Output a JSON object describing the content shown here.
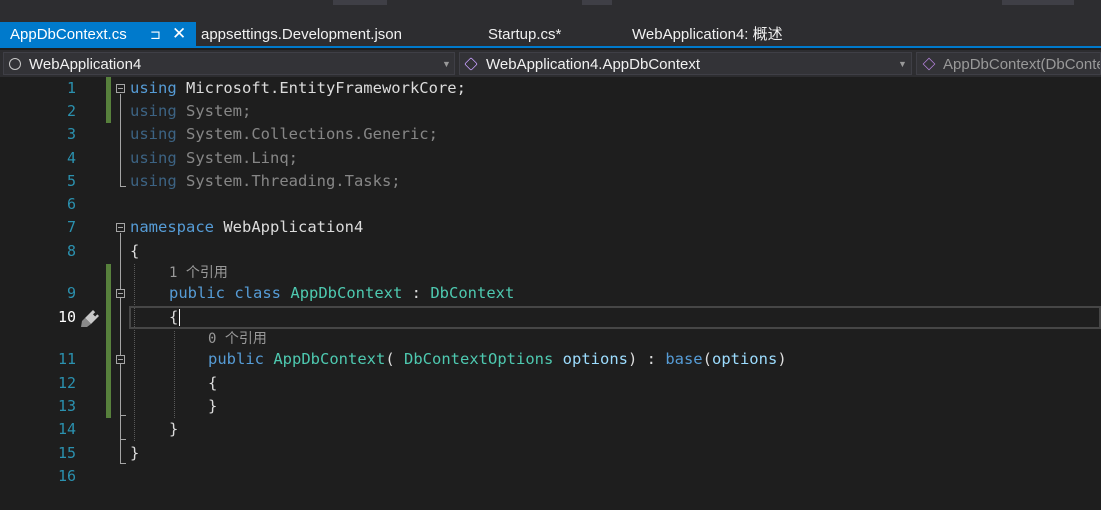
{
  "tabs": [
    {
      "label": "AppDbContext.cs",
      "active": true,
      "pin": "⊐",
      "close": "✕"
    },
    {
      "label": "appsettings.Development.json",
      "active": false
    },
    {
      "label": "Startup.cs*",
      "active": false
    },
    {
      "label": "WebApplication4: 概述",
      "active": false
    }
  ],
  "nav": {
    "project": "WebApplication4",
    "type": "WebApplication4.AppDbContext",
    "member": "AppDbContext(DbContextOptions options)"
  },
  "code": {
    "line_numbers": [
      "1",
      "2",
      "3",
      "4",
      "5",
      "6",
      "7",
      "8",
      "9",
      "10",
      "11",
      "12",
      "13",
      "14",
      "15",
      "16"
    ],
    "using1_kw": "using",
    "using1_rest": " Microsoft.EntityFrameworkCore;",
    "using2_kw": "using",
    "using2_rest": " System;",
    "using3_kw": "using",
    "using3_rest": " System.Collections.Generic;",
    "using4_kw": "using",
    "using4_rest": " System.Linq;",
    "using5_kw": "using",
    "using5_rest": " System.Threading.Tasks;",
    "ns_kw": "namespace",
    "ns_name": " WebApplication4",
    "open_brace": "{",
    "lens_class": "1 个引用",
    "cls_public": "public",
    "cls_class": "class",
    "cls_name": "AppDbContext",
    "cls_colon": " : ",
    "cls_base": "DbContext",
    "class_open": "{",
    "lens_ctor": "0 个引用",
    "ctor_public": "public",
    "ctor_name": "AppDbContext",
    "ctor_paren": "( ",
    "ctor_type": "DbContextOptions",
    "ctor_param": "options",
    "ctor_mid": ") : ",
    "ctor_base": "base",
    "ctor_arg_open": "(",
    "ctor_arg": "options",
    "ctor_arg_close": ")",
    "ctor_open": "{",
    "ctor_close": "}",
    "class_close": "}",
    "ns_close": "}"
  },
  "colors": {
    "keyword": "#569cd6",
    "type": "#4ec9b0",
    "parameter": "#9cdcfe",
    "line_number": "#2b91af",
    "accent": "#007acc",
    "change_bar": "#57803c"
  },
  "icons": [
    "project-icon",
    "class-icon",
    "method-cube-icon",
    "quick-actions-brush-icon"
  ]
}
